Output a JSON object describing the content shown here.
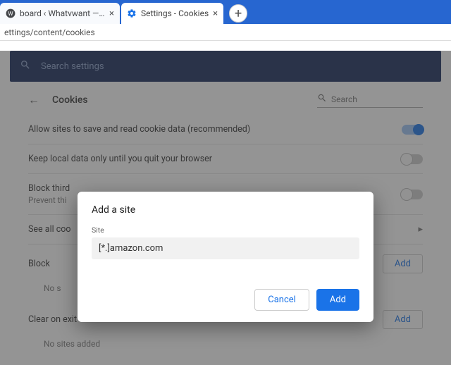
{
  "tabs": [
    {
      "title": "board ‹ Whatvwant — Word"
    },
    {
      "title": "Settings - Cookies"
    }
  ],
  "url": "ettings/content/cookies",
  "search_settings_placeholder": "Search settings",
  "page_title": "Cookies",
  "header_search_placeholder": "Search",
  "rows": {
    "allow_cookies": "Allow sites to save and read cookie data (recommended)",
    "keep_local": "Keep local data only until you quit your browser",
    "block_third": {
      "title": "Block third",
      "subtitle": "Prevent thi"
    },
    "see_all": "See all coo"
  },
  "sections": {
    "block": {
      "label": "Block",
      "empty": "No s",
      "add": "Add"
    },
    "clear_on_exit": {
      "label": "Clear on exit",
      "empty": "No sites added",
      "add": "Add"
    }
  },
  "dialog": {
    "title": "Add a site",
    "field_label": "Site",
    "value": "[*.]amazon.com",
    "cancel": "Cancel",
    "add": "Add"
  }
}
